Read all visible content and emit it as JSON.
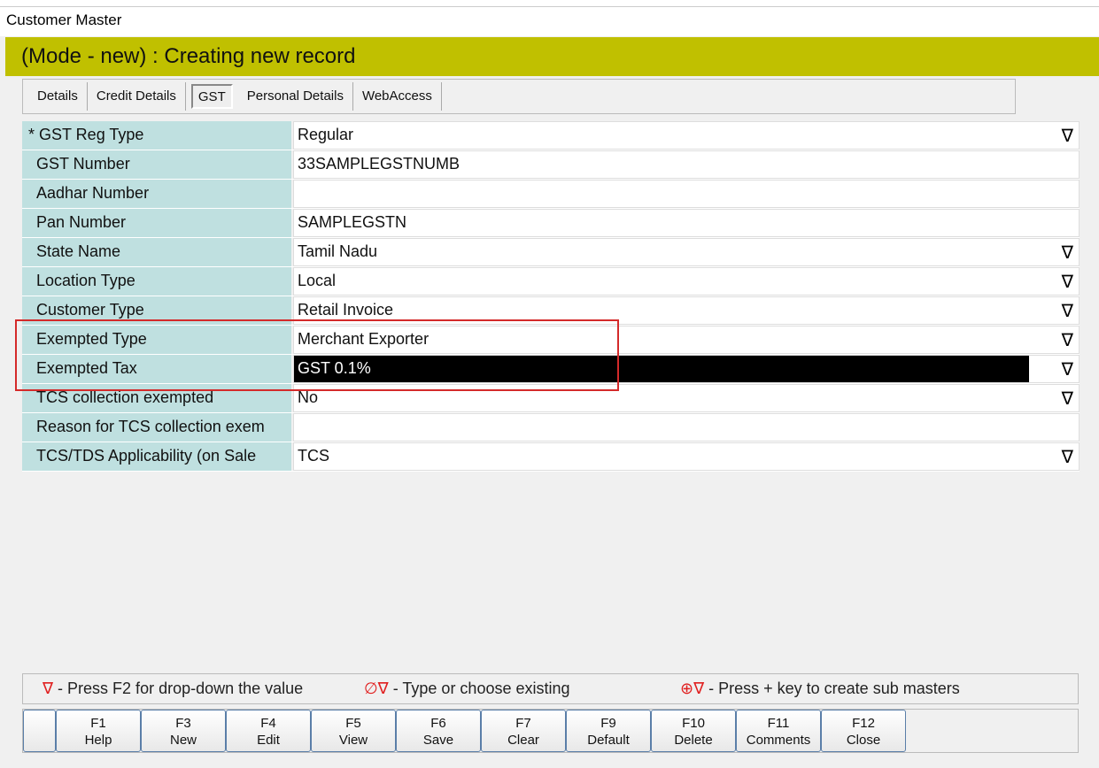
{
  "window": {
    "title": "Customer Master"
  },
  "mode_banner": "(Mode - new) : Creating new record",
  "tabs": [
    {
      "label": "Details"
    },
    {
      "label": "Credit Details"
    },
    {
      "label": "GST",
      "active": true
    },
    {
      "label": "Personal Details"
    },
    {
      "label": "WebAccess"
    }
  ],
  "fields": [
    {
      "label": "* GST Reg Type",
      "value": "Regular",
      "dropdown": true
    },
    {
      "label": "GST Number",
      "value": "33SAMPLEGSTNUMB",
      "dropdown": false
    },
    {
      "label": "Aadhar Number",
      "value": "",
      "dropdown": false
    },
    {
      "label": "Pan Number",
      "value": "SAMPLEGSTN",
      "dropdown": false
    },
    {
      "label": "State Name",
      "value": "Tamil Nadu",
      "dropdown": true
    },
    {
      "label": "Location Type",
      "value": "Local",
      "dropdown": true
    },
    {
      "label": "Customer Type",
      "value": "Retail Invoice",
      "dropdown": true
    },
    {
      "label": "Exempted Type",
      "value": "Merchant Exporter",
      "dropdown": true
    },
    {
      "label": "Exempted Tax",
      "value": "GST 0.1%",
      "dropdown": true,
      "selected": true
    },
    {
      "label": "TCS collection exempted",
      "value": "No",
      "dropdown": true
    },
    {
      "label": "Reason for TCS collection exem",
      "value": "",
      "dropdown": false
    },
    {
      "label": "TCS/TDS Applicability (on Sale",
      "value": "TCS",
      "dropdown": true
    }
  ],
  "dropdown_glyph": "∇",
  "legend": {
    "item1_icon": "∇",
    "item1_text": " - Press F2 for drop-down the value",
    "item2_icon": "∅∇",
    "item2_text": " - Type or choose existing",
    "item3_icon": "⊕∇",
    "item3_text": " - Press + key to create sub masters"
  },
  "function_keys": [
    {
      "key": "F1",
      "label": "Help"
    },
    {
      "key": "F3",
      "label": "New"
    },
    {
      "key": "F4",
      "label": "Edit"
    },
    {
      "key": "F5",
      "label": "View"
    },
    {
      "key": "F6",
      "label": "Save"
    },
    {
      "key": "F7",
      "label": "Clear"
    },
    {
      "key": "F9",
      "label": "Default"
    },
    {
      "key": "F10",
      "label": "Delete"
    },
    {
      "key": "F11",
      "label": "Comments"
    },
    {
      "key": "F12",
      "label": "Close"
    }
  ],
  "colors": {
    "banner": "#c0c000",
    "label_bg": "#bfe0e0",
    "highlight_box": "#d42a2a"
  }
}
